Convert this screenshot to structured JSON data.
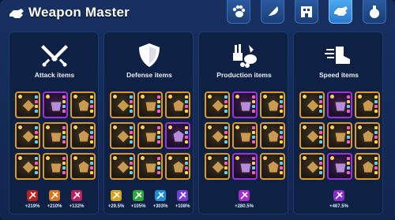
{
  "window": {
    "title": "Weapon Master"
  },
  "tabs": [
    {
      "icon": "paw-icon",
      "active": false
    },
    {
      "icon": "feather-icon",
      "active": false
    },
    {
      "icon": "building-icon",
      "active": false
    },
    {
      "icon": "fist-icon",
      "active": true
    },
    {
      "icon": "potion-icon",
      "active": false
    }
  ],
  "panels": [
    {
      "title": "Attack items",
      "icon": "crossed-swords-icon",
      "slots": [
        "gold",
        "purple",
        "gold",
        "gold",
        "gold",
        "gold",
        "gold",
        "gold",
        "gold"
      ],
      "bonuses": [
        {
          "icon": "sword-bonus-icon",
          "color": "#b8201e",
          "value": "+219%"
        },
        {
          "icon": "spear-bonus-icon",
          "color": "#d8741a",
          "value": "+210%"
        },
        {
          "icon": "horse-bonus-icon",
          "color": "#b8205e",
          "value": "+132%"
        }
      ]
    },
    {
      "title": "Defense items",
      "icon": "shield-icon",
      "slots": [
        "gold",
        "gold",
        "gold",
        "gold",
        "gold",
        "purple",
        "gold",
        "gold",
        "gold"
      ],
      "bonuses": [
        {
          "icon": "tent-bonus-icon",
          "color": "#d8a21a",
          "value": "+29.5%"
        },
        {
          "icon": "flag-bonus-icon",
          "color": "#2aa83a",
          "value": "+105%"
        },
        {
          "icon": "shield-bonus-icon",
          "color": "#1a8fd8",
          "value": "+303%"
        },
        {
          "icon": "horse-bonus-icon",
          "color": "#7a3ad8",
          "value": "+108%"
        }
      ]
    },
    {
      "title": "Production items",
      "icon": "resources-icon",
      "slots": [
        "gold",
        "purple",
        "gold",
        "gold",
        "gold",
        "gold",
        "gold",
        "purple",
        "gold"
      ],
      "bonuses": [
        {
          "icon": "crate-bonus-icon",
          "color": "#a82ac8",
          "value": "+280.5%"
        }
      ]
    },
    {
      "title": "Speed items",
      "icon": "winged-boot-icon",
      "slots": [
        "gold",
        "purple",
        "gold",
        "gold",
        "gold",
        "gold",
        "gold",
        "purple",
        "gold"
      ],
      "bonuses": [
        {
          "icon": "boot-bonus-icon",
          "color": "#8a2ac8",
          "value": "+467.5%"
        }
      ]
    }
  ]
}
